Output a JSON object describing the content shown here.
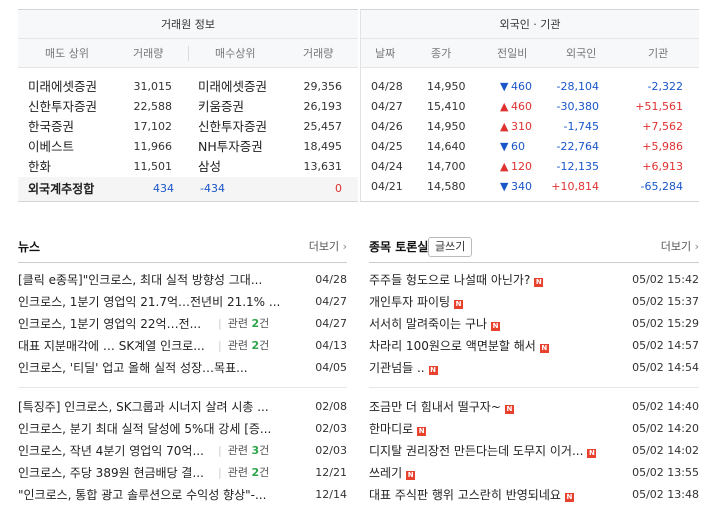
{
  "broker": {
    "group_title": "거래원 정보",
    "headers": [
      "매도 상위",
      "거래량",
      "매수상위",
      "거래량"
    ],
    "rows": [
      {
        "sell_name": "미래에셋증권",
        "sell_vol": "31,015",
        "buy_name": "미래에셋증권",
        "buy_vol": "29,356"
      },
      {
        "sell_name": "신한투자증권",
        "sell_vol": "22,588",
        "buy_name": "키움증권",
        "buy_vol": "26,193"
      },
      {
        "sell_name": "한국증권",
        "sell_vol": "17,102",
        "buy_name": "신한투자증권",
        "buy_vol": "25,457"
      },
      {
        "sell_name": "이베스트",
        "sell_vol": "11,966",
        "buy_name": "NH투자증권",
        "buy_vol": "18,495"
      },
      {
        "sell_name": "한화",
        "sell_vol": "11,501",
        "buy_name": "삼성",
        "buy_vol": "13,631"
      }
    ],
    "total": {
      "label": "외국계추정합",
      "sell": "434",
      "buy": "-434",
      "net": "0"
    }
  },
  "foreign": {
    "group_title": "외국인 · 기관",
    "headers": [
      "날짜",
      "종가",
      "전일비",
      "외국인",
      "기관"
    ],
    "rows": [
      {
        "date": "04/28",
        "close": "14,950",
        "dir": "down",
        "change": "460",
        "foreign": "-28,104",
        "inst": "-2,322"
      },
      {
        "date": "04/27",
        "close": "15,410",
        "dir": "up",
        "change": "460",
        "foreign": "-30,380",
        "inst": "+51,561"
      },
      {
        "date": "04/26",
        "close": "14,950",
        "dir": "up",
        "change": "310",
        "foreign": "-1,745",
        "inst": "+7,562"
      },
      {
        "date": "04/25",
        "close": "14,640",
        "dir": "down",
        "change": "60",
        "foreign": "-22,764",
        "inst": "+5,986"
      },
      {
        "date": "04/24",
        "close": "14,700",
        "dir": "up",
        "change": "120",
        "foreign": "-12,135",
        "inst": "+6,913"
      },
      {
        "date": "04/21",
        "close": "14,580",
        "dir": "down",
        "change": "340",
        "foreign": "+10,814",
        "inst": "-65,284"
      }
    ]
  },
  "news": {
    "title": "뉴스",
    "more": "더보기",
    "related_label": "관련",
    "related_unit": "건",
    "items": [
      {
        "title": "[클릭 e종목]\"인크로스, 최대 실적 방향성 그대...",
        "related": "",
        "date": "04/28"
      },
      {
        "title": "인크로스, 1분기 영업익 21.7억…전년비 21.1% ...",
        "related": "",
        "date": "04/27"
      },
      {
        "title": "인크로스, 1분기 영업익 22억…전...",
        "related": "2",
        "date": "04/27"
      },
      {
        "title": "대표 지분매각에 … SK계열 인크로...",
        "related": "2",
        "date": "04/13"
      },
      {
        "title": "인크로스, '티딜' 업고 올해 실적 성장…목표...",
        "related": "",
        "date": "04/05"
      },
      {
        "title": "[특징주] 인크로스, SK그룹과 시너지 살려 시총 ...",
        "related": "",
        "date": "02/08"
      },
      {
        "title": "인크로스, 분기 최대 실적 달성에 5%대 강세 [증...",
        "related": "",
        "date": "02/03"
      },
      {
        "title": "인크로스, 작년 4분기 영업익 70억...",
        "related": "3",
        "date": "02/03"
      },
      {
        "title": "인크로스, 주당 389원 현금배당 결...",
        "related": "2",
        "date": "12/21"
      },
      {
        "title": "\"인크로스, 통합 광고 솔루션으로 수익성 향상\"-...",
        "related": "",
        "date": "12/14"
      }
    ]
  },
  "board": {
    "title": "종목 토론실",
    "write_label": "글쓰기",
    "more": "더보기",
    "badge": "N",
    "items": [
      {
        "title": "주주들 헝도으로 나설때 아닌가?",
        "date": "05/02 15:42"
      },
      {
        "title": "개인투자 파이팅",
        "date": "05/02 15:37"
      },
      {
        "title": "서서히 말려죽이는 구나",
        "date": "05/02 15:29"
      },
      {
        "title": "차라리 100원으로 액면분할 해서",
        "date": "05/02 14:57"
      },
      {
        "title": "기관넘들 ..",
        "date": "05/02 14:54"
      },
      {
        "title": "조금만 더 힘내서 떨구자~",
        "date": "05/02 14:40"
      },
      {
        "title": "한마디로",
        "date": "05/02 14:20"
      },
      {
        "title": "디지탈 권리장전 만든다는데 도무지 이거...",
        "date": "05/02 14:02"
      },
      {
        "title": "쓰레기",
        "date": "05/02 13:55"
      },
      {
        "title": "대표 주식판 행위 고스란히 반영되네요",
        "date": "05/02 13:48"
      }
    ]
  },
  "colors": {
    "up": "#e03131",
    "down": "#1a56c8",
    "related_count": "#2ea54a",
    "new_badge": "#e8412d"
  }
}
